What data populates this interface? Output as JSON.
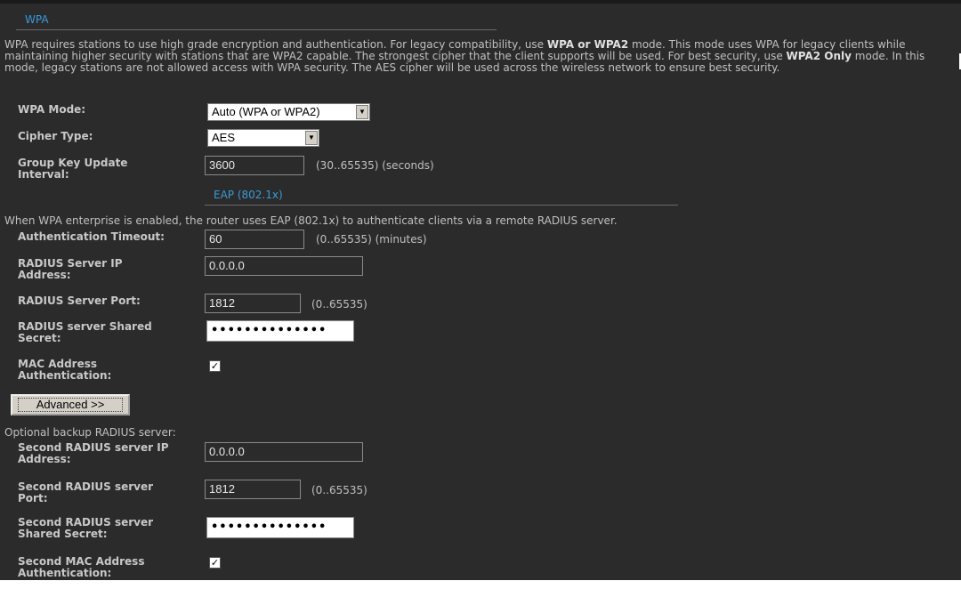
{
  "wpa": {
    "section_title": "WPA",
    "description_parts": [
      "WPA requires stations to use high grade encryption and authentication. For legacy compatibility, use ",
      "WPA or WPA2",
      " mode. This mode uses WPA for legacy clients while maintaining higher security with stations that are WPA2 capable. The strongest cipher that the client supports will be used. For best security, use ",
      "WPA2 Only",
      " mode. In this mode, legacy stations are not allowed access with WPA security. The AES cipher will be used across the wireless network to ensure best security."
    ],
    "mode_label": "WPA Mode:",
    "mode_value": "Auto (WPA or WPA2)",
    "cipher_label": "Cipher Type:",
    "cipher_value": "AES",
    "group_key_label": "Group Key Update Interval:",
    "group_key_value": "3600",
    "group_key_note": "(30..65535) (seconds)"
  },
  "eap": {
    "section_title": "EAP (802.1x)",
    "description": "When WPA enterprise is enabled, the router uses EAP (802.1x) to authenticate clients via a remote RADIUS server.",
    "auth_timeout_label": "Authentication Timeout:",
    "auth_timeout_value": "60",
    "auth_timeout_note": "(0..65535) (minutes)",
    "radius_ip_label": "RADIUS Server IP Address:",
    "radius_ip_value": "0.0.0.0",
    "radius_port_label": "RADIUS Server Port:",
    "radius_port_value": "1812",
    "radius_port_note": "(0..65535)",
    "radius_secret_label": "RADIUS server Shared Secret:",
    "radius_secret_value": "••••••••••••••",
    "mac_auth_label": "MAC Address Authentication:",
    "mac_auth_checked": true,
    "advanced_button": "Advanced >>",
    "backup_note": "Optional backup RADIUS server:",
    "second_ip_label": "Second RADIUS server IP Address:",
    "second_ip_value": "0.0.0.0",
    "second_port_label": "Second RADIUS server Port:",
    "second_port_value": "1812",
    "second_port_note": "(0..65535)",
    "second_secret_label": "Second RADIUS server Shared Secret:",
    "second_secret_value": "••••••••••••••",
    "second_mac_label": "Second MAC Address Authentication:",
    "second_mac_checked": true
  },
  "colors": {
    "background": "#2b2b2b",
    "section_title": "#3a9ad9",
    "text": "#c8c8c8"
  }
}
